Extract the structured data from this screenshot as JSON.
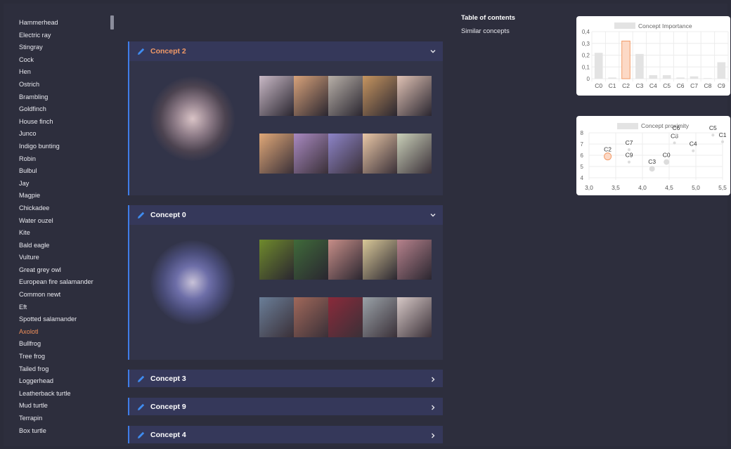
{
  "sidebar": {
    "items": [
      {
        "label": "Hammerhead"
      },
      {
        "label": "Electric ray"
      },
      {
        "label": "Stingray"
      },
      {
        "label": "Cock"
      },
      {
        "label": "Hen"
      },
      {
        "label": "Ostrich"
      },
      {
        "label": "Brambling"
      },
      {
        "label": "Goldfinch"
      },
      {
        "label": "House finch"
      },
      {
        "label": "Junco"
      },
      {
        "label": "Indigo bunting"
      },
      {
        "label": "Robin"
      },
      {
        "label": "Bulbul"
      },
      {
        "label": "Jay"
      },
      {
        "label": "Magpie"
      },
      {
        "label": "Chickadee"
      },
      {
        "label": "Water ouzel"
      },
      {
        "label": "Kite"
      },
      {
        "label": "Bald eagle"
      },
      {
        "label": "Vulture"
      },
      {
        "label": "Great grey owl"
      },
      {
        "label": "European fire salamander"
      },
      {
        "label": "Common newt"
      },
      {
        "label": "Eft"
      },
      {
        "label": "Spotted salamander"
      },
      {
        "label": "Axolotl",
        "active": true
      },
      {
        "label": "Bullfrog"
      },
      {
        "label": "Tree frog"
      },
      {
        "label": "Tailed frog"
      },
      {
        "label": "Loggerhead"
      },
      {
        "label": "Leatherback turtle"
      },
      {
        "label": "Mud turtle"
      },
      {
        "label": "Terrapin"
      },
      {
        "label": "Box turtle"
      }
    ]
  },
  "toc": {
    "title": "Table of contents",
    "links": [
      "Similar concepts"
    ]
  },
  "panels": [
    {
      "title": "Concept 2",
      "expanded": true,
      "highlight": true,
      "row1": [
        "#c9b9c6",
        "#d8a27a",
        "#b8b0a8",
        "#c69560",
        "#e0c2b4"
      ],
      "row2": [
        "#e0a878",
        "#a889c0",
        "#8d84c8",
        "#e9c7a6",
        "#c9cfb8"
      ]
    },
    {
      "title": "Concept 0",
      "expanded": true,
      "highlight": false,
      "row1": [
        "#6f8a2c",
        "#3f6a3a",
        "#c78e88",
        "#d9c898",
        "#b6828c"
      ],
      "row2": [
        "#6a7e98",
        "#a0685a",
        "#8a2a3a",
        "#9aa2a8",
        "#d6c8c6"
      ]
    },
    {
      "title": "Concept 3",
      "expanded": false
    },
    {
      "title": "Concept 9",
      "expanded": false
    },
    {
      "title": "Concept 4",
      "expanded": false
    }
  ],
  "colors": {
    "accent": "#3f7de8",
    "highlight": "#f29a67",
    "bar": "#e3e3e3",
    "bar_highlight": "#fcd9c6",
    "bar_highlight_border": "#f29a67"
  },
  "chart_data": [
    {
      "type": "bar",
      "title": "Concept Importance",
      "legend": "Concept Importance",
      "categories": [
        "C0",
        "C1",
        "C2",
        "C3",
        "C4",
        "C5",
        "C6",
        "C7",
        "C8",
        "C9"
      ],
      "values": [
        0.22,
        0.01,
        0.32,
        0.21,
        0.03,
        0.03,
        0.01,
        0.02,
        0.005,
        0.14
      ],
      "highlight_index": 2,
      "ylim": [
        0,
        0.4
      ],
      "yticks": [
        0,
        0.1,
        0.2,
        0.3,
        0.4
      ],
      "ytick_labels": [
        "0",
        "0,1",
        "0,2",
        "0,3",
        "0,4"
      ],
      "grid": true
    },
    {
      "type": "scatter",
      "title": "Concept proximity",
      "legend": "Concept proximity",
      "points": [
        {
          "label": "C2",
          "x": 3.35,
          "y": 5.9,
          "highlight": true
        },
        {
          "label": "C7",
          "x": 3.75,
          "y": 6.5
        },
        {
          "label": "C9",
          "x": 3.75,
          "y": 5.4
        },
        {
          "label": "C3",
          "x": 4.18,
          "y": 4.8
        },
        {
          "label": "C0",
          "x": 4.45,
          "y": 5.4
        },
        {
          "label": "C8",
          "x": 4.6,
          "y": 7.1
        },
        {
          "label": "C6",
          "x": 4.63,
          "y": 7.8
        },
        {
          "label": "C4",
          "x": 4.95,
          "y": 6.4
        },
        {
          "label": "C5",
          "x": 5.32,
          "y": 7.8
        },
        {
          "label": "C1",
          "x": 5.5,
          "y": 7.2
        }
      ],
      "xlim": [
        3.0,
        5.5
      ],
      "ylim": [
        4,
        8
      ],
      "xticks": [
        3.0,
        3.5,
        4.0,
        4.5,
        5.0,
        5.5
      ],
      "xtick_labels": [
        "3,0",
        "3,5",
        "4,0",
        "4,5",
        "5,0",
        "5,5"
      ],
      "yticks": [
        4,
        5,
        6,
        7,
        8
      ],
      "ytick_labels": [
        "4",
        "5",
        "6",
        "7",
        "8"
      ],
      "grid": true
    }
  ]
}
